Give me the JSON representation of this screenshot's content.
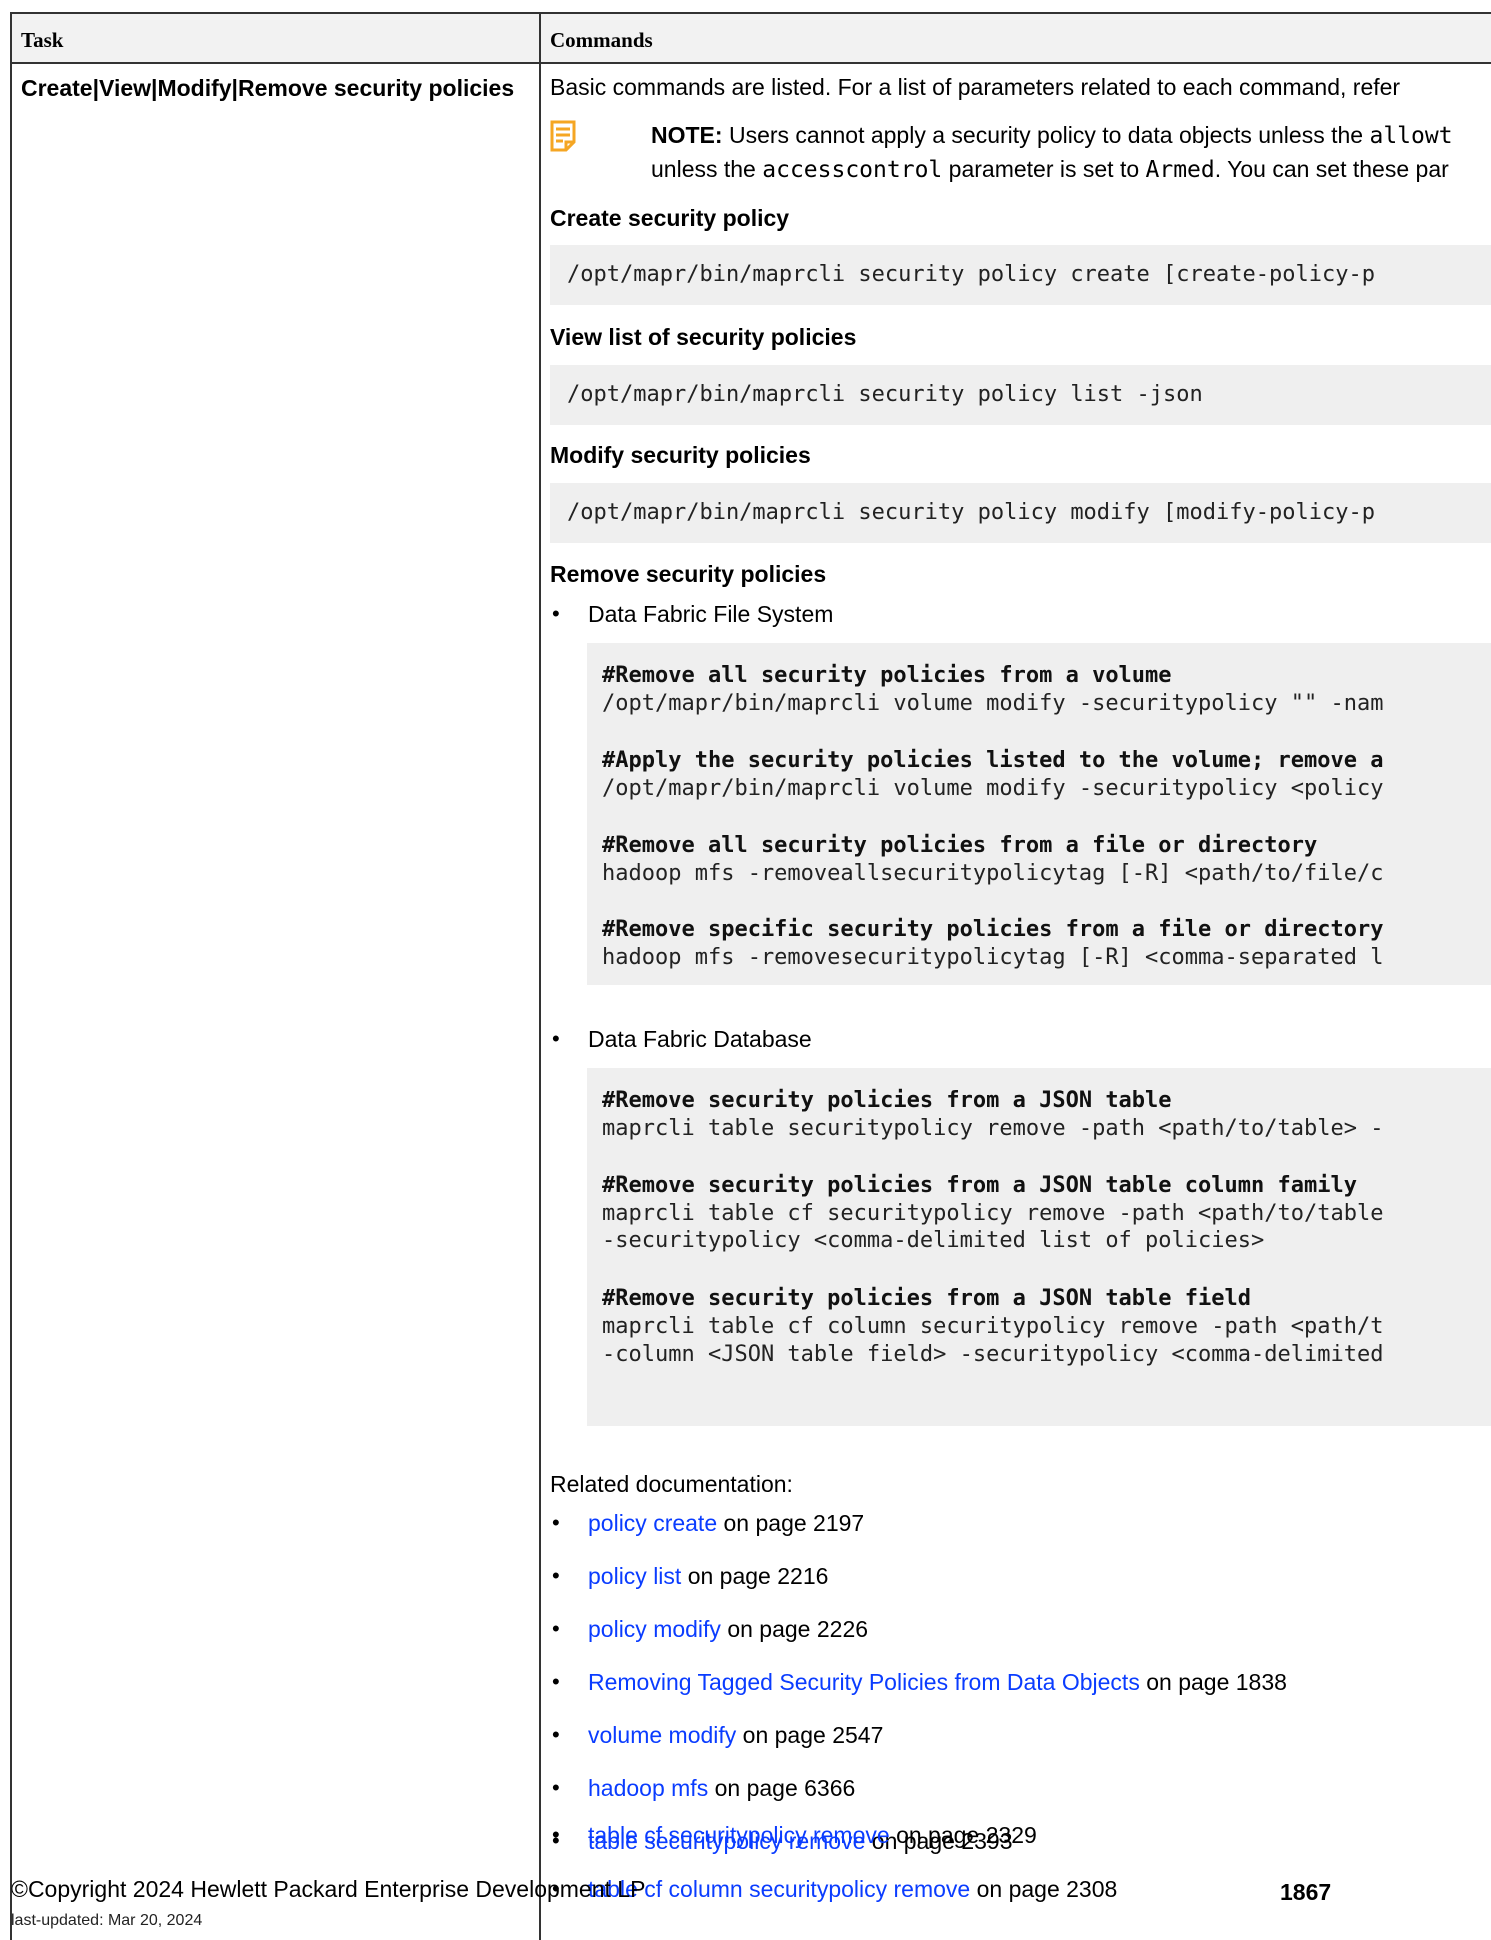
{
  "table": {
    "headers": [
      "Task",
      "Commands"
    ],
    "task": "Create|View|Modify|Remove security policies"
  },
  "intro": "Basic commands are listed. For a list of parameters related to each command, refer",
  "note": {
    "icon": "note-icon",
    "label": "NOTE:",
    "line1_a": "Users cannot apply a security policy to data objects unless the ",
    "line1_code": "allowt",
    "line2_a": "unless the ",
    "line2_code": "accesscontrol",
    "line2_b": " parameter is set to ",
    "line2_code2": "Armed",
    "line2_c": ". You can set these par"
  },
  "sections": {
    "create": {
      "heading": "Create security policy",
      "code": "/opt/mapr/bin/maprcli security policy create [create-policy-p"
    },
    "view": {
      "heading": "View list of security policies",
      "code": "/opt/mapr/bin/maprcli security policy list -json"
    },
    "modify": {
      "heading": "Modify security policies",
      "code": "/opt/mapr/bin/maprcli security policy modify [modify-policy-p"
    },
    "remove": {
      "heading": "Remove security policies"
    }
  },
  "fs": {
    "bullet": "Data Fabric File System",
    "lines": [
      {
        "text": "#Remove all security policies from a volume",
        "bold": true
      },
      {
        "text": "/opt/mapr/bin/maprcli volume modify -securitypolicy \"\" -nam",
        "bold": false
      },
      {
        "text": "#Apply the security policies listed to the volume; remove a",
        "bold": true
      },
      {
        "text": "/opt/mapr/bin/maprcli volume modify -securitypolicy <policy",
        "bold": false
      },
      {
        "text": "#Remove all security policies from a file or directory",
        "bold": true
      },
      {
        "text": "hadoop mfs -removeallsecuritypolicytag [-R] <path/to/file/c",
        "bold": false
      },
      {
        "text": "#Remove specific security policies from a file or directory",
        "bold": true
      },
      {
        "text": "hadoop mfs -removesecuritypolicytag [-R] <comma-separated l",
        "bold": false
      }
    ]
  },
  "db": {
    "bullet": "Data Fabric Database",
    "lines": [
      {
        "text": "#Remove security policies from a JSON table",
        "bold": true
      },
      {
        "text": "maprcli table securitypolicy remove -path <path/to/table> -",
        "bold": false
      },
      {
        "text": "#Remove security policies from a JSON table column family",
        "bold": true
      },
      {
        "text": "maprcli table cf securitypolicy remove -path <path/to/table",
        "bold": false
      },
      {
        "text": "-securitypolicy <comma-delimited list of policies>",
        "bold": false
      },
      {
        "text": "#Remove security policies from a JSON table field",
        "bold": true
      },
      {
        "text": "maprcli table cf column securitypolicy remove -path <path/t",
        "bold": false
      },
      {
        "text": "-column <JSON table field> -securitypolicy <comma-delimited",
        "bold": false
      }
    ]
  },
  "related": {
    "label": "Related documentation:",
    "items": [
      {
        "link": "policy create",
        "page": " on page 2197"
      },
      {
        "link": "policy list",
        "page": " on page 2216"
      },
      {
        "link": "policy modify",
        "page": " on page 2226"
      },
      {
        "link": "Removing Tagged Security Policies from Data Objects",
        "page": " on page 1838"
      },
      {
        "link": "volume modify",
        "page": " on page 2547"
      },
      {
        "link": "hadoop mfs",
        "page": " on page 6366"
      },
      {
        "link": "table securitypolicy remove",
        "page": " on page 2393"
      },
      {
        "link": "table cf securitypolicy remove",
        "page": " on page 2329"
      },
      {
        "link": "table cf column securitypolicy remove",
        "page": " on page 2308"
      }
    ]
  },
  "footer": {
    "copyright": "©Copyright 2024 Hewlett Packard Enterprise Development LP",
    "updated": "last-updated: Mar 20, 2024",
    "page": "1867"
  },
  "colors": {
    "link": "#0a3cff",
    "note_icon": "#f5a623",
    "code_bg": "#efefef"
  }
}
